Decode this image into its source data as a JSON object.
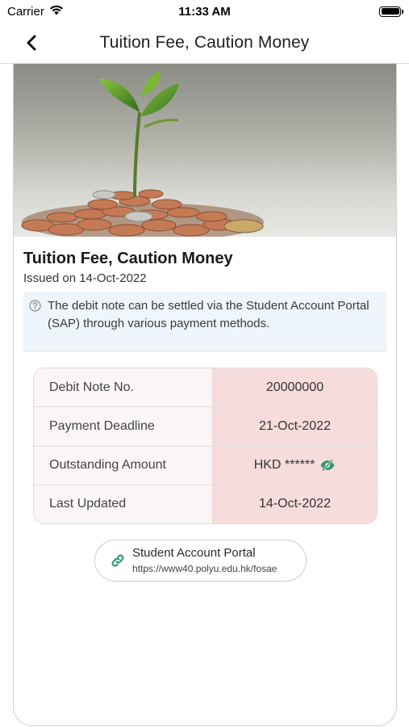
{
  "status_bar": {
    "carrier": "Carrier",
    "time": "11:33 AM"
  },
  "nav": {
    "title": "Tuition Fee, Caution Money",
    "back_icon": "chevron-left-icon"
  },
  "note": {
    "title": "Tuition Fee, Caution Money",
    "issued": "Issued on 14-Oct-2022",
    "info_text": "The debit note can be settled via the Student Account Portal (SAP) through various payment methods.",
    "rows": [
      {
        "label": "Debit Note No.",
        "value": "20000000"
      },
      {
        "label": "Payment Deadline",
        "value": "21-Oct-2022"
      },
      {
        "label": "Outstanding Amount",
        "value": "HKD ******"
      },
      {
        "label": "Last Updated",
        "value": "14-Oct-2022"
      }
    ]
  },
  "portal": {
    "label": "Student Account Portal",
    "url": "https://www40.polyu.edu.hk/fosae",
    "icon": "link-icon"
  },
  "colors": {
    "accent_green": "#2e9a70",
    "value_bg": "#f7dcdc",
    "label_bg": "#faf6f6",
    "notice_bg": "#eef5fb"
  }
}
